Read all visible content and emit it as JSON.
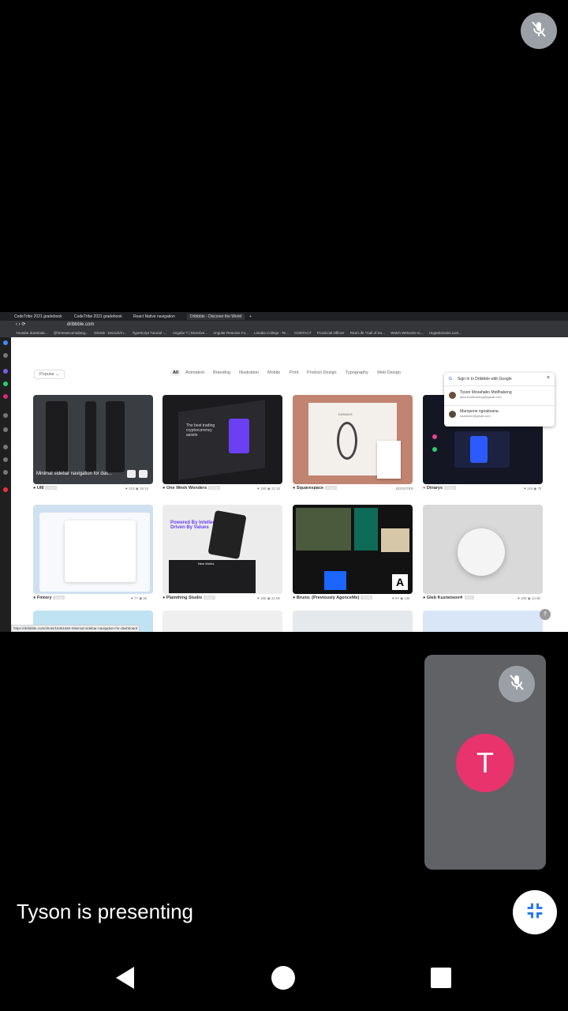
{
  "meeting": {
    "presenting_text": "Tyson is presenting",
    "participant_initial": "T",
    "avatar_color": "#e8336d",
    "mic_state": "muted"
  },
  "browser": {
    "tabs": [
      {
        "label": "CodeTribe 2021 gradebook"
      },
      {
        "label": "CodeTribe 2021 gradebook"
      },
      {
        "label": "React Native navigation"
      },
      {
        "label": "Dribbble - Discover the World"
      }
    ],
    "url": "dribbble.com",
    "bookmarks": [
      "Youtube downlode...",
      "@fortewecomsdang...",
      "GitHub - bensch/rn...",
      "TypeScript Tutorial -...",
      "Angular 7 | Directive...",
      "Angular Reactive Fo...",
      "Limaba College - Te...",
      "CONTACT",
      "Provincial Offices",
      "Real Life *Call of Du...",
      "Watch Welcome to...",
      "Hugedomains.com..."
    ],
    "status_url": "https://dribbble.com/shots/16451584-Minimal-sidebar-navigation-for-dashboard"
  },
  "dribbble": {
    "popular_label": "Popular",
    "categories": [
      "All",
      "Animation",
      "Branding",
      "Illustration",
      "Mobile",
      "Print",
      "Product Design",
      "Typography",
      "Web Design"
    ],
    "signin": {
      "title": "Sign in to Dribbble with Google",
      "accounts": [
        {
          "name": "Tyson Movahabo Motlhabeng",
          "email": "tysonmotlhabeng@gmail.com"
        },
        {
          "name": "Maropene ngoakoana",
          "email": "kazatomr@gmail.com"
        }
      ]
    },
    "shots": [
      {
        "author": "UI8",
        "badge": "TEAM",
        "likes": "219",
        "views": "18.1k",
        "overlay": "Minimal sidebar navigation for das..."
      },
      {
        "author": "One Week Wonders",
        "badge": "TEAM",
        "likes": "188",
        "views": "22.2k"
      },
      {
        "author": "Squarespace",
        "badge": "TEAM",
        "extra": "BOOSTED"
      },
      {
        "author": "Dinarys",
        "badge": "TEAM",
        "likes": "116",
        "views": "7k"
      },
      {
        "author": "Fintory",
        "badge": "TEAM",
        "likes": "77",
        "views": "5k"
      },
      {
        "author": "Plainthing Studio",
        "badge": "TEAM",
        "likes": "185",
        "views": "22.9k"
      },
      {
        "author": "Bruno. (Previously AgenceMe)",
        "badge": "TEAM",
        "likes": "97",
        "views": "13k"
      },
      {
        "author": "Gleb Kuznetsov✈",
        "badge": "PRO",
        "likes": "109",
        "views": "14.8k"
      }
    ],
    "card_texts": {
      "crypto": "The best trading cryptocurrency assets",
      "powered": "Powered By Intellect Driven By Values",
      "new_works": "New Works",
      "kosmos": "KØSMOS"
    }
  }
}
